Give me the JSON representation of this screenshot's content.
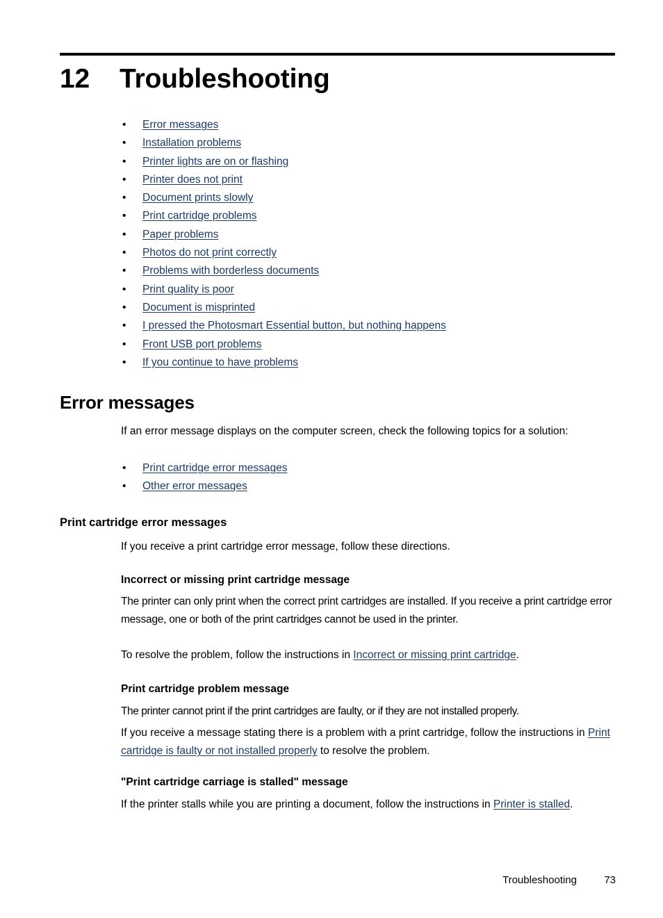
{
  "chapter": {
    "number": "12",
    "title": "Troubleshooting"
  },
  "toc_links": [
    {
      "label": "Error messages"
    },
    {
      "label": "Installation problems"
    },
    {
      "label": "Printer lights are on or flashing"
    },
    {
      "label": "Printer does not print"
    },
    {
      "label": "Document prints slowly"
    },
    {
      "label": "Print cartridge problems"
    },
    {
      "label": "Paper problems"
    },
    {
      "label": "Photos do not print correctly"
    },
    {
      "label": "Problems with borderless documents"
    },
    {
      "label": "Print quality is poor"
    },
    {
      "label": "Document is misprinted"
    },
    {
      "label": "I pressed the Photosmart Essential button, but nothing happens"
    },
    {
      "label": "Front USB port problems"
    },
    {
      "label": "If you continue to have problems"
    }
  ],
  "bullet_glyph": "•",
  "error_messages": {
    "heading": "Error messages",
    "intro": "If an error message displays on the computer screen, check the following topics for a solution:",
    "links": [
      {
        "label": "Print cartridge error messages"
      },
      {
        "label": "Other error messages"
      }
    ]
  },
  "print_cartridge_error_messages": {
    "heading": "Print cartridge error messages",
    "intro": "If you receive a print cartridge error message, follow these directions.",
    "subsections": {
      "incorrect_or_missing": {
        "heading": "Incorrect or missing print cartridge message",
        "paragraph_1": "The printer can only print when the correct print cartridges are installed. If you receive a print cartridge error message, one or both of the print cartridges cannot be used in the printer.",
        "paragraph_2_before": "To resolve the problem, follow the instructions in ",
        "paragraph_2_link": "Incorrect or missing print cartridge",
        "paragraph_2_after": "."
      },
      "problem_message": {
        "heading": "Print cartridge problem message",
        "paragraph_1": "The printer cannot print if the print cartridges are faulty, or if they are not installed properly.",
        "paragraph_2_before": "If you receive a message stating there is a problem with a print cartridge, follow the instructions in ",
        "paragraph_2_link": "Print cartridge is faulty or not installed properly",
        "paragraph_2_after": " to resolve the problem."
      },
      "carriage_stalled": {
        "heading": "\"Print cartridge carriage is stalled\" message",
        "paragraph_1_before": "If the printer stalls while you are printing a document, follow the instructions in ",
        "paragraph_1_link": "Printer is stalled",
        "paragraph_1_after": "."
      }
    }
  },
  "footer": {
    "section_label": "Troubleshooting",
    "page_number": "73"
  },
  "colors": {
    "link": "#1b3a66",
    "text": "#000000",
    "rule": "#000000"
  }
}
